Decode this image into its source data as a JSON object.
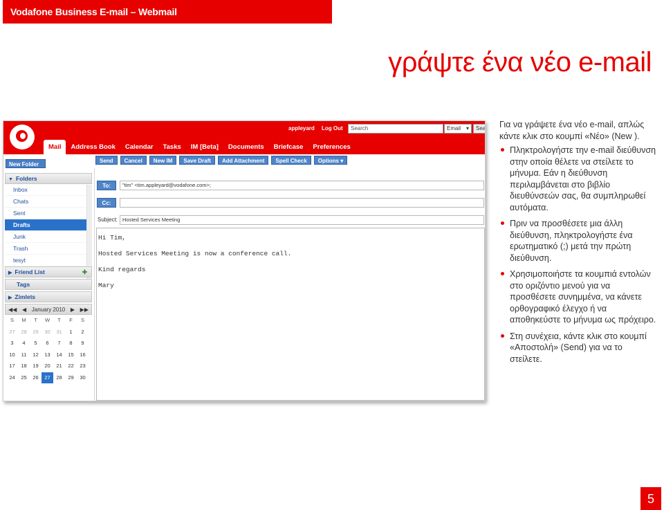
{
  "header": {
    "brand": "Vodafone Business E-mail – Webmail"
  },
  "page": {
    "title": "γράψτε ένα νέο e-mail",
    "number": "5"
  },
  "screenshot": {
    "top_links": [
      "appleyard",
      "Log Out"
    ],
    "search": {
      "placeholder": "Search",
      "type": "Email",
      "button": "Sea"
    },
    "tabs": [
      "Mail",
      "Address Book",
      "Calendar",
      "Tasks",
      "IM [Beta]",
      "Documents",
      "Briefcase",
      "Preferences"
    ],
    "new_folder": "New Folder",
    "toolbar": [
      "Send",
      "Cancel",
      "New IM",
      "Save Draft",
      "Add Attachment",
      "Spell Check",
      "Options"
    ],
    "folders_header": "Folders",
    "folders": [
      "Inbox",
      "Chats",
      "Sent",
      "Drafts",
      "Junk",
      "Trash",
      "tesyt"
    ],
    "selected_folder": "Drafts",
    "friend_list": "Friend List",
    "tags": "Tags",
    "zimlets": "Zimlets",
    "calendar": {
      "month": "January 2010",
      "dow": [
        "S",
        "M",
        "T",
        "W",
        "T",
        "F",
        "S"
      ],
      "days": [
        "27",
        "28",
        "29",
        "30",
        "31",
        "1",
        "2",
        "3",
        "4",
        "5",
        "6",
        "7",
        "8",
        "9",
        "10",
        "11",
        "12",
        "13",
        "14",
        "15",
        "16",
        "17",
        "18",
        "19",
        "20",
        "21",
        "22",
        "23",
        "24",
        "25",
        "26",
        "27",
        "28",
        "29",
        "30"
      ],
      "today": "27"
    },
    "compose": {
      "to_label": "To:",
      "to_value": "\"tim\" <tim.appleyard@vodafone.com>;",
      "cc_label": "Cc:",
      "cc_value": "",
      "subject_label": "Subject:",
      "subject_value": "Hosted Services Meeting",
      "body": [
        "Hi Tim,",
        "Hosted Services Meeting is now a conference call.",
        "Kind regards",
        "Mary"
      ]
    }
  },
  "instructions": {
    "intro": "Για να γράψετε ένα νέο e-mail, απλώς κάντε κλικ στο κουμπί «Νέο» (New ).",
    "bullets": [
      "Πληκτρολογήστε την e-mail διεύθυνση στην οποία θέλετε να στείλετε το μήνυμα. Εάν η διεύθυνση περιλαμβάνεται στο βιβλίο διευθύνσεών σας, θα συμπληρωθεί αυτόματα.",
      "Πριν να προσθέσετε μια άλλη διεύθυνση, πληκτρολογήστε ένα ερωτηματικό (;) μετά την πρώτη διεύθυνση.",
      "Χρησιμοποιήστε τα κουμπιά εντολών στο οριζόντιο μενού για να προσθέσετε συνημμένα, να κάνετε ορθογραφικό έλεγχο ή να αποθηκεύστε το μήνυμα ως πρόχειρο.",
      "Στη συνέχεια, κάντε κλικ στο κουμπί «Αποστολή» (Send) για να το στείλετε."
    ]
  },
  "colors": {
    "brand_red": "#e60000",
    "link_blue": "#1f4e9a",
    "button_blue": "#4f84c8"
  }
}
